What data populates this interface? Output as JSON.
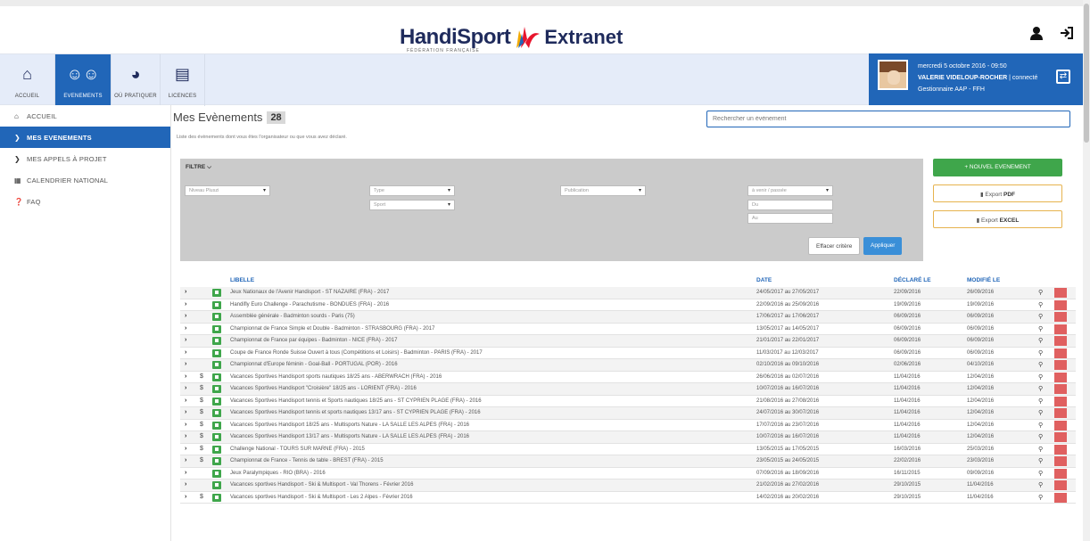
{
  "header": {
    "brand_left": "HandiSport",
    "brand_sub": "FÉDÉRATION FRANÇAISE",
    "brand_right": "Extranet"
  },
  "nav": [
    {
      "label": "ACCUEIL",
      "icon": "home-icon"
    },
    {
      "label": "EVENEMENTS",
      "icon": "users-icon"
    },
    {
      "label": "OÙ PRATIQUER",
      "icon": "map-icon"
    },
    {
      "label": "LICENCES",
      "icon": "id-card-icon"
    }
  ],
  "user": {
    "datetime": "mercredi 5 octobre 2016 - 09:50",
    "name": "VALERIE VIDELOUP-ROCHER",
    "status": "| connecté",
    "role": "Gestionnaire AAP - FFH"
  },
  "sidebar": [
    {
      "label": "ACCUEIL",
      "active": false
    },
    {
      "label": "MES EVENEMENTS",
      "active": true
    },
    {
      "label": "MES APPELS À PROJET",
      "active": false
    },
    {
      "label": "CALENDRIER NATIONAL",
      "active": false
    },
    {
      "label": "FAQ",
      "active": false
    }
  ],
  "page": {
    "title": "Mes Evènements",
    "count": "28",
    "description": "Liste des évènements dont vous êtes l'organisateur ou que vous avez déclaré.",
    "search_placeholder": "Rechercher un évènement"
  },
  "filter": {
    "title": "FILTRE",
    "niveau": "Niveau Pluszi",
    "type": "Type",
    "sport": "Sport",
    "publication": "Publication",
    "a_venir": "à venir / passée",
    "du": "Du",
    "au": "Au",
    "clear_label": "Effacer critère",
    "apply_label": "Appliquer"
  },
  "actions": {
    "new_event": "+ NOUVEL EVENEMENT",
    "export_pdf_pre": "Export",
    "export_pdf": "PDF",
    "export_excel_pre": "Export",
    "export_excel": "EXCEL"
  },
  "table": {
    "headers": {
      "libelle": "LIBELLE",
      "date": "DATE",
      "declare": "DÉCLARÉ LE",
      "modifie": "MODIFIÉ LE"
    },
    "rows": [
      {
        "libelle": "Jeux Nationaux de l'Avenir Handisport - ST NAZAIRE (FRA) - 2017",
        "date": "24/05/2017 au 27/05/2017",
        "declare": "22/09/2016",
        "modifie": "26/09/2016",
        "dollar": ""
      },
      {
        "libelle": "Handifly Euro Challenge - Parachutisme - BONDUES (FRA) - 2016",
        "date": "22/09/2016 au 25/09/2016",
        "declare": "19/09/2016",
        "modifie": "19/09/2016",
        "dollar": ""
      },
      {
        "libelle": "Assemblée générale - Badminton sourds - Paris (75)",
        "date": "17/06/2017 au 17/06/2017",
        "declare": "06/09/2016",
        "modifie": "06/09/2016",
        "dollar": ""
      },
      {
        "libelle": "Championnat de France Simple et Double - Badminton - STRASBOURG (FRA) - 2017",
        "date": "13/05/2017 au 14/05/2017",
        "declare": "06/09/2016",
        "modifie": "06/09/2016",
        "dollar": ""
      },
      {
        "libelle": "Championnat de France par équipes - Badminton - NICE (FRA) - 2017",
        "date": "21/01/2017 au 22/01/2017",
        "declare": "06/09/2016",
        "modifie": "06/09/2016",
        "dollar": ""
      },
      {
        "libelle": "Coupe de France Ronde Suisse Ouvert à tous (Compétitions et Loisirs) - Badminton - PARIS (FRA) - 2017",
        "date": "11/03/2017 au 12/03/2017",
        "declare": "06/09/2016",
        "modifie": "06/09/2016",
        "dollar": ""
      },
      {
        "libelle": "Championnat d'Europe féminin - Goal-Ball - PORTUGAL (POR) - 2016",
        "date": "02/10/2016 au 09/10/2016",
        "declare": "02/06/2016",
        "modifie": "04/10/2016",
        "dollar": ""
      },
      {
        "libelle": "Vacances Sportives Handisport sports nautiques 18/25 ans - ABERWRACH (FRA) - 2016",
        "date": "26/06/2016 au 02/07/2016",
        "declare": "11/04/2016",
        "modifie": "12/04/2016",
        "dollar": "$"
      },
      {
        "libelle": "Vacances Sportives Handisport \"Croisière\" 18/25 ans - LORIENT (FRA) - 2016",
        "date": "10/07/2016 au 16/07/2016",
        "declare": "11/04/2016",
        "modifie": "12/04/2016",
        "dollar": "$"
      },
      {
        "libelle": "Vacances Sportives Handisport tennis et Sports nautiques 18/25 ans - ST CYPRIEN PLAGE (FRA) - 2016",
        "date": "21/08/2016 au 27/08/2016",
        "declare": "11/04/2016",
        "modifie": "12/04/2016",
        "dollar": "$"
      },
      {
        "libelle": "Vacances Sportives Handisport tennis et sports nautiques 13/17 ans - ST CYPRIEN PLAGE (FRA) - 2016",
        "date": "24/07/2016 au 30/07/2016",
        "declare": "11/04/2016",
        "modifie": "12/04/2016",
        "dollar": "$"
      },
      {
        "libelle": "Vacances Sportives Handisport 18/25 ans - Multisports Nature - LA SALLE LES ALPES (FRA) - 2016",
        "date": "17/07/2016 au 23/07/2016",
        "declare": "11/04/2016",
        "modifie": "12/04/2016",
        "dollar": "$"
      },
      {
        "libelle": "Vacances Sportives Handisport 13/17 ans - Multisports Nature - LA SALLE LES ALPES (FRA) - 2016",
        "date": "10/07/2016 au 16/07/2016",
        "declare": "11/04/2016",
        "modifie": "12/04/2016",
        "dollar": "$"
      },
      {
        "libelle": "Challenge National - TOURS SUR MARNE (FRA) - 2015",
        "date": "13/05/2015 au 17/05/2015",
        "declare": "16/03/2016",
        "modifie": "25/03/2016",
        "dollar": "$"
      },
      {
        "libelle": "Championnat de France - Tennis de table - BREST (FRA) - 2015",
        "date": "23/05/2015 au 24/05/2015",
        "declare": "22/02/2016",
        "modifie": "23/03/2016",
        "dollar": "$"
      },
      {
        "libelle": "Jeux Paralympiques - RIO (BRA) - 2016",
        "date": "07/09/2016 au 18/09/2016",
        "declare": "16/11/2015",
        "modifie": "09/09/2016",
        "dollar": ""
      },
      {
        "libelle": "Vacances sportives Handisport - Ski & Multisport - Val Thorens - Février 2016",
        "date": "21/02/2016 au 27/02/2016",
        "declare": "29/10/2015",
        "modifie": "11/04/2016",
        "dollar": ""
      },
      {
        "libelle": "Vacances sportives Handisport - Ski & Multisport - Les 2 Alpes - Février 2016",
        "date": "14/02/2016 au 20/02/2016",
        "declare": "29/10/2015",
        "modifie": "11/04/2016",
        "dollar": "$"
      }
    ]
  }
}
